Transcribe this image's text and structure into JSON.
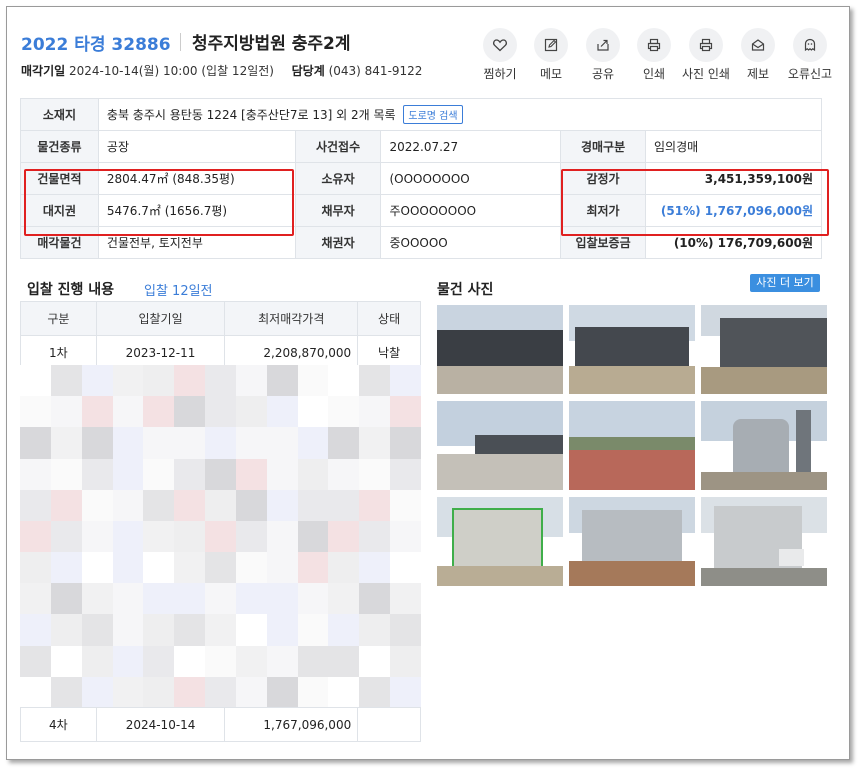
{
  "header": {
    "case_number": "2022 타경 32886",
    "court": "청주지방법원 충주2계",
    "sale_date_label": "매각기일",
    "sale_date_value": "2024-10-14(월) 10:00 (입찰 12일전)",
    "manager_label": "담당계",
    "manager_phone": "(043) 841-9122"
  },
  "actions": [
    {
      "label": "찜하기",
      "icon": "heart-icon"
    },
    {
      "label": "메모",
      "icon": "pencil-icon"
    },
    {
      "label": "공유",
      "icon": "share-icon"
    },
    {
      "label": "인쇄",
      "icon": "printer-icon"
    },
    {
      "label": "사진 인쇄",
      "icon": "printer-icon"
    },
    {
      "label": "제보",
      "icon": "envelope-icon"
    },
    {
      "label": "오류신고",
      "icon": "ghost-icon"
    }
  ],
  "info": {
    "location_label": "소재지",
    "location_value": "충북 충주시 용탄동 1224 [충주산단7로 13] 외 2개 목록",
    "road_search_button": "도로명 검색",
    "type_label": "물건종류",
    "type_value": "공장",
    "received_label": "사건접수",
    "received_value": "2022.07.27",
    "auction_type_label": "경매구분",
    "auction_type_value": "임의경매",
    "building_area_label": "건물면적",
    "building_area_value": "2804.47㎡ (848.35평)",
    "owner_label": "소유자",
    "owner_value": "(OOOOOOOO",
    "appraisal_label": "감정가",
    "appraisal_value": "3,451,359,100원",
    "land_right_label": "대지권",
    "land_right_value": "5476.7㎡ (1656.7평)",
    "debtor_label": "채무자",
    "debtor_value": "주OOOOOOOO",
    "minimum_label": "최저가",
    "minimum_value": "(51%) 1,767,096,000원",
    "sale_item_label": "매각물건",
    "sale_item_value": "건물전부, 토지전부",
    "creditor_label": "채권자",
    "creditor_value": "중OOOOO",
    "deposit_label": "입찰보증금",
    "deposit_value": "(10%) 176,709,600원"
  },
  "bidding": {
    "title": "입찰 진행 내용",
    "subtitle": "입찰 12일전",
    "columns": [
      "구분",
      "입찰기일",
      "최저매각가격",
      "상태"
    ],
    "rows": [
      {
        "round": "1차",
        "date": "2023-12-11",
        "price": "2,208,870,000",
        "status": "낙찰"
      },
      {
        "round": "4차",
        "date": "2024-10-14",
        "price": "1,767,096,000",
        "status": ""
      }
    ]
  },
  "photos": {
    "title": "물건 사진",
    "more_button": "사진 더 보기",
    "count": 9
  },
  "colors": {
    "accent": "#3b7dd8",
    "highlight_border": "#e02020",
    "header_cell_bg": "#f3f5f8"
  }
}
